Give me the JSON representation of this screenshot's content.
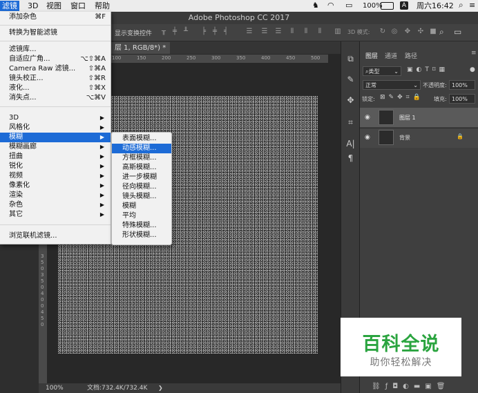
{
  "menubar": {
    "items": [
      "滤镜",
      "3D",
      "视图",
      "窗口",
      "帮助"
    ],
    "status": "100%",
    "clock": "周六16:42",
    "input_badge": "A"
  },
  "window": {
    "title": "Adobe Photoshop CC 2017"
  },
  "options_bar": {
    "transform_label": "显示变换控件",
    "mode_3d": "3D 模式:"
  },
  "document": {
    "tab_label": "层 1, RGB/8*) *",
    "hruler_ticks": [
      "100",
      "150",
      "200",
      "250",
      "300",
      "350",
      "400",
      "450",
      "500"
    ],
    "vruler_ticks": [
      "3",
      "5",
      "0",
      "3",
      "5",
      "0",
      "4",
      "0",
      "0",
      "4",
      "5",
      "0"
    ]
  },
  "status_bar": {
    "zoom": "100%",
    "doc_size": "文档:732.4K/732.4K"
  },
  "filter_menu": {
    "items": [
      {
        "label": "添加杂色",
        "shortcut": "⌘F"
      },
      {
        "label": "转换为智能滤镜"
      },
      {
        "label": "滤镜库..."
      },
      {
        "label": "自适应广角...",
        "shortcut": "⌥⇧⌘A"
      },
      {
        "label": "Camera Raw 滤镜...",
        "shortcut": "⇧⌘A"
      },
      {
        "label": "镜头校正...",
        "shortcut": "⇧⌘R"
      },
      {
        "label": "液化...",
        "shortcut": "⇧⌘X"
      },
      {
        "label": "消失点...",
        "shortcut": "⌥⌘V"
      },
      {
        "label": "3D",
        "arrow": "▶"
      },
      {
        "label": "风格化",
        "arrow": "▶"
      },
      {
        "label": "模糊",
        "arrow": "▶"
      },
      {
        "label": "模糊画廊",
        "arrow": "▶"
      },
      {
        "label": "扭曲",
        "arrow": "▶"
      },
      {
        "label": "锐化",
        "arrow": "▶"
      },
      {
        "label": "视频",
        "arrow": "▶"
      },
      {
        "label": "像素化",
        "arrow": "▶"
      },
      {
        "label": "渲染",
        "arrow": "▶"
      },
      {
        "label": "杂色",
        "arrow": "▶"
      },
      {
        "label": "其它",
        "arrow": "▶"
      },
      {
        "label": "浏览联机滤镜..."
      }
    ]
  },
  "blur_submenu": {
    "items": [
      "表面模糊...",
      "动感模糊...",
      "方框模糊...",
      "高斯模糊...",
      "进一步模糊",
      "径向模糊...",
      "镜头模糊...",
      "模糊",
      "平均",
      "特殊模糊...",
      "形状模糊..."
    ]
  },
  "layers_panel": {
    "tabs": [
      "图层",
      "通道",
      "路径"
    ],
    "kind_filter": "类型",
    "blend_mode": "正常",
    "opacity_label": "不透明度:",
    "opacity_value": "100%",
    "lock_label": "锁定:",
    "fill_label": "填充:",
    "fill_value": "100%",
    "layers": [
      {
        "name": "图层 1",
        "selected": true
      },
      {
        "name": "背景",
        "selected": false
      }
    ]
  },
  "watermark": {
    "title": "百科全说",
    "subtitle": "助你轻松解决"
  }
}
